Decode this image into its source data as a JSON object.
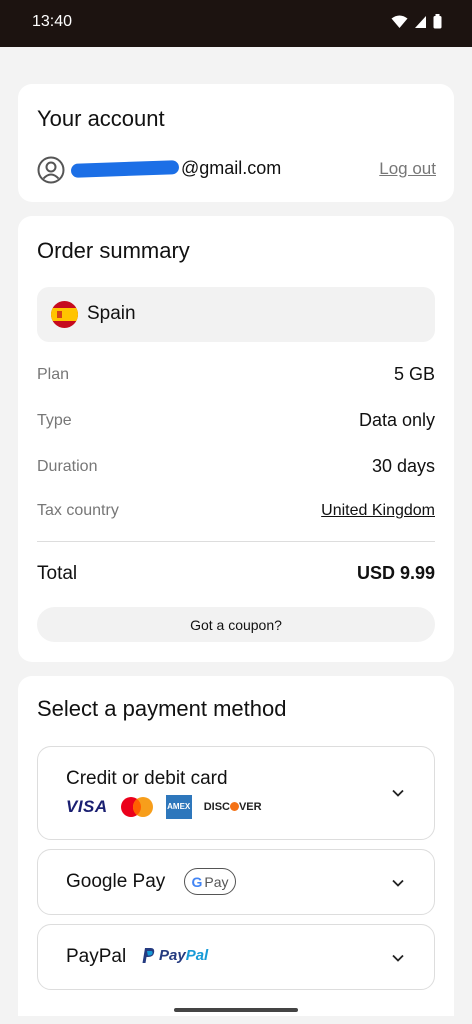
{
  "status_bar": {
    "time": "13:40"
  },
  "account": {
    "title": "Your account",
    "email_suffix": "@gmail.com",
    "logout_label": "Log out"
  },
  "order": {
    "title": "Order summary",
    "country": "Spain",
    "rows": [
      {
        "label": "Plan",
        "value": "5 GB"
      },
      {
        "label": "Type",
        "value": "Data only"
      },
      {
        "label": "Duration",
        "value": "30 days"
      },
      {
        "label": "Tax country",
        "value": "United Kingdom"
      }
    ],
    "total_label": "Total",
    "total_value": "USD 9.99",
    "coupon_label": "Got a coupon?"
  },
  "payment": {
    "title": "Select a payment method",
    "methods": [
      {
        "label": "Credit or debit card",
        "brands": [
          "VISA",
          "Mastercard",
          "AMEX",
          "DISCOVER"
        ]
      },
      {
        "label": "Google Pay",
        "badge": "G Pay"
      },
      {
        "label": "PayPal",
        "badge_a": "Pay",
        "badge_b": "Pal"
      }
    ]
  },
  "colors": {
    "status_bar": "#1c1310",
    "background": "#f3f3f3",
    "card": "#ffffff",
    "muted_text": "#777777"
  }
}
